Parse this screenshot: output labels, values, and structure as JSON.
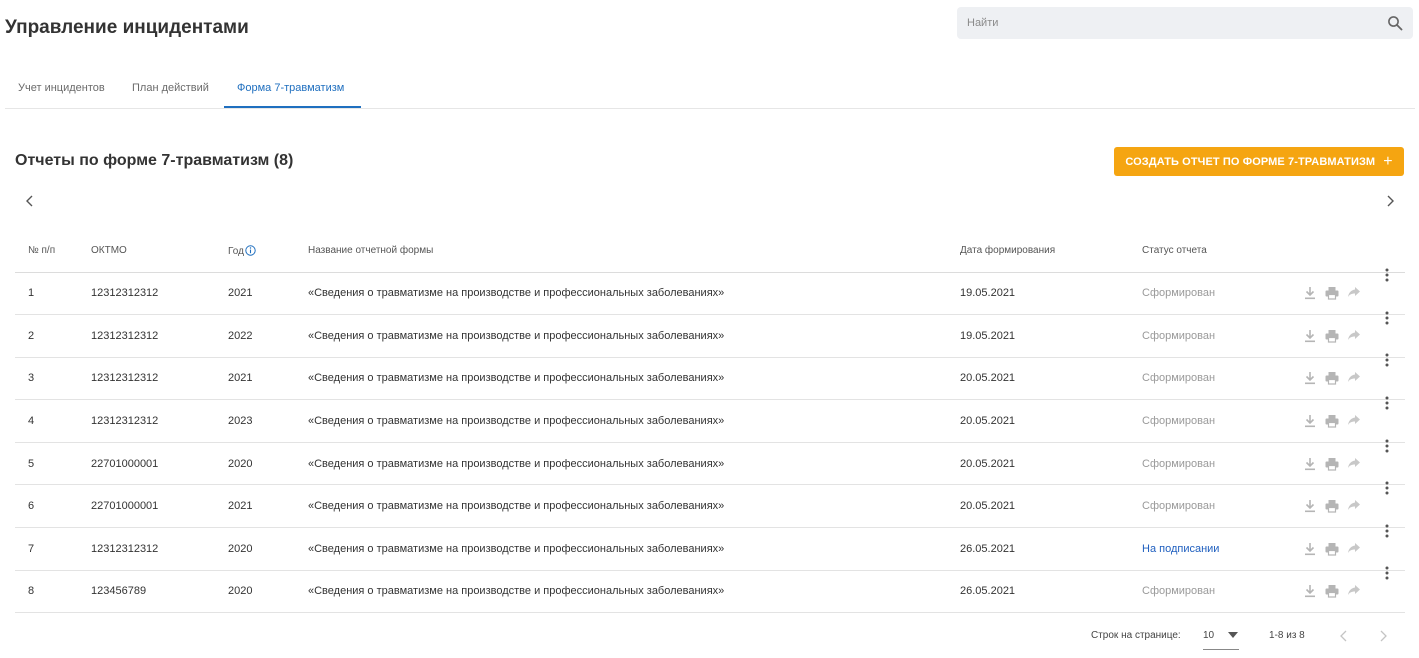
{
  "header": {
    "title": "Управление инцидентами",
    "search_placeholder": "Найти"
  },
  "tabs": [
    {
      "label": "Учет инцидентов",
      "active": false
    },
    {
      "label": "План действий",
      "active": false
    },
    {
      "label": "Форма 7-травматизм",
      "active": true
    }
  ],
  "section": {
    "title": "Отчеты по форме 7-травматизм (8)",
    "create_button": "СОЗДАТЬ ОТЧЕТ ПО ФОРМЕ 7-ТРАВМАТИЗМ"
  },
  "table": {
    "columns": [
      "№ п/п",
      "ОКТМО",
      "Год",
      "Название отчетной формы",
      "Дата формирования",
      "Статус отчета"
    ],
    "rows": [
      {
        "num": "1",
        "oktmo": "12312312312",
        "year": "2021",
        "name": "«Сведения о травматизме на производстве и профессиональных заболеваниях»",
        "date": "19.05.2021",
        "status": "Сформирован"
      },
      {
        "num": "2",
        "oktmo": "12312312312",
        "year": "2022",
        "name": "«Сведения о травматизме на производстве и профессиональных заболеваниях»",
        "date": "19.05.2021",
        "status": "Сформирован"
      },
      {
        "num": "3",
        "oktmo": "12312312312",
        "year": "2021",
        "name": "«Сведения о травматизме на производстве и профессиональных заболеваниях»",
        "date": "20.05.2021",
        "status": "Сформирован"
      },
      {
        "num": "4",
        "oktmo": "12312312312",
        "year": "2023",
        "name": "«Сведения о травматизме на производстве и профессиональных заболеваниях»",
        "date": "20.05.2021",
        "status": "Сформирован"
      },
      {
        "num": "5",
        "oktmo": "22701000001",
        "year": "2020",
        "name": "«Сведения о травматизме на производстве и профессиональных заболеваниях»",
        "date": "20.05.2021",
        "status": "Сформирован"
      },
      {
        "num": "6",
        "oktmo": "22701000001",
        "year": "2021",
        "name": "«Сведения о травматизме на производстве и профессиональных заболеваниях»",
        "date": "20.05.2021",
        "status": "Сформирован"
      },
      {
        "num": "7",
        "oktmo": "12312312312",
        "year": "2020",
        "name": "«Сведения о травматизме на производстве и профессиональных заболеваниях»",
        "date": "26.05.2021",
        "status": "На подписании"
      },
      {
        "num": "8",
        "oktmo": "123456789",
        "year": "2020",
        "name": "«Сведения о травматизме на производстве и профессиональных заболеваниях»",
        "date": "26.05.2021",
        "status": "Сформирован"
      }
    ]
  },
  "pagination": {
    "rows_per_page_label": "Строк на странице:",
    "rows_per_page": "10",
    "range": "1-8 из 8"
  },
  "colors": {
    "accent": "#1f6fbf",
    "button": "#f5a511",
    "status_pending": "#1f5fbf",
    "status_done": "#9a9a9a"
  },
  "icons": [
    "search-icon",
    "info-icon",
    "download-icon",
    "print-icon",
    "share-icon",
    "more-vert-icon",
    "chevron-left-icon",
    "chevron-right-icon",
    "caret-down-icon",
    "plus-icon"
  ]
}
